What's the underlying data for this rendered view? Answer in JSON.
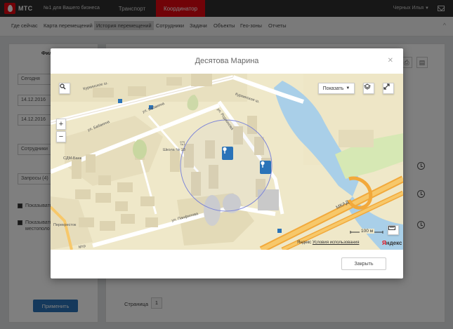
{
  "topbar": {
    "brand": "МТС",
    "slogan": "№1 для Вашего бизнеса",
    "tabs": [
      {
        "label": "Транспорт"
      },
      {
        "label": "Координатор"
      }
    ],
    "user": "Черных Илья",
    "colors": {
      "brand": "#e30611",
      "bar": "#2e2e2e"
    }
  },
  "nav": {
    "items": [
      "Где сейчас",
      "Карта перемещений",
      "История перемещений",
      "Сотрудники",
      "Задачи",
      "Объекты",
      "Гео-зоны",
      "Отчеты"
    ],
    "active": "История перемещений"
  },
  "sidebar": {
    "title": "Фильтр с",
    "period": "Сегодня",
    "date_from": "14.12.2016",
    "date_to": "14.12.2016",
    "employees": "Сотрудники",
    "requests": "Запросы (4)",
    "check1": "Показывать ошибкой",
    "check2": "Показывать \"последние местополо",
    "apply": "Применить"
  },
  "main": {
    "pager_label": "Страница",
    "page": "1"
  },
  "modal": {
    "title": "Десятова Марина",
    "close_label": "Закрыть",
    "map": {
      "show_button": "Показать",
      "scale": "100 м",
      "attribution_brand": "Яндекс",
      "attribution_link": "Условия использования",
      "logo_first": "Я",
      "logo_rest": "ндекс",
      "labels": {
        "kurkinskoe_left": "Куркинское ш.",
        "kurkinskoe_right": "Куркинское ш.",
        "babakina_1": "ул. Бабакина",
        "babakina_2": "ул. Бабакина",
        "rodionova": "ул. Родионова",
        "panfilova": "ул. Панфилова",
        "mkad": "МКАД",
        "school": "Школа № 18",
        "sdm_bank": "СДМ-Банк",
        "perekrestok": "Перекресток",
        "mtr": "Мтр"
      },
      "marker_color": "#2a73b8"
    }
  }
}
